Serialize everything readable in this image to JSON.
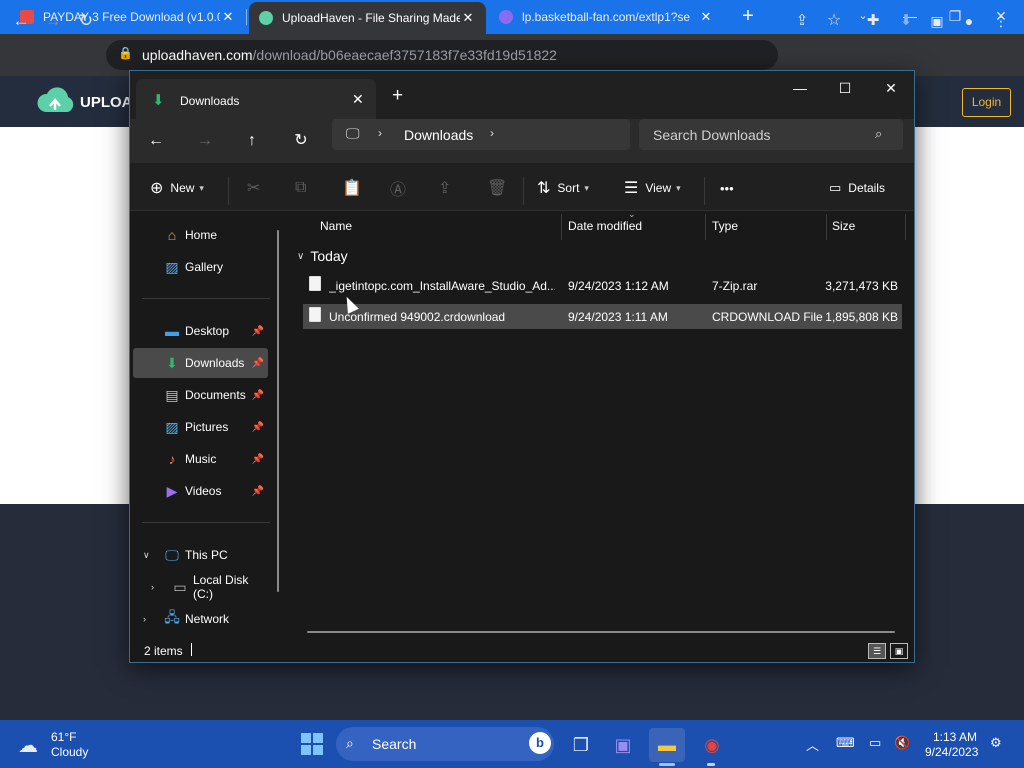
{
  "browser": {
    "tabs": [
      {
        "title": "PAYDAY 3 Free Download (v1.0.0",
        "active": false
      },
      {
        "title": "UploadHaven - File Sharing Made",
        "active": true
      },
      {
        "title": "lp.basketball-fan.com/extlp1?se",
        "active": false
      }
    ],
    "url_domain": "uploadhaven.com",
    "url_path": "/download/b06eaecaef3757183f7e33fd19d51822"
  },
  "site": {
    "name": "UPLOA",
    "login_label": "Login",
    "accent_color": "#f2b632"
  },
  "explorer": {
    "tab_title": "Downloads",
    "address": {
      "location": "Downloads"
    },
    "search_placeholder": "Search Downloads",
    "commands": {
      "new": "New",
      "sort": "Sort",
      "view": "View",
      "more": "•••",
      "details": "Details"
    },
    "sidebar": {
      "quick": [
        {
          "label": "Home",
          "icon": "home-icon"
        },
        {
          "label": "Gallery",
          "icon": "gallery-icon"
        }
      ],
      "pinned": [
        {
          "label": "Desktop",
          "icon": "desktop-icon"
        },
        {
          "label": "Downloads",
          "icon": "download-icon",
          "selected": true
        },
        {
          "label": "Documents",
          "icon": "documents-icon"
        },
        {
          "label": "Pictures",
          "icon": "pictures-icon"
        },
        {
          "label": "Music",
          "icon": "music-icon"
        },
        {
          "label": "Videos",
          "icon": "videos-icon"
        }
      ],
      "tree": [
        {
          "label": "This PC",
          "icon": "computer-icon",
          "expanded": true
        },
        {
          "label": "Local Disk (C:)",
          "icon": "drive-icon"
        },
        {
          "label": "Network",
          "icon": "network-icon"
        }
      ]
    },
    "columns": {
      "name": "Name",
      "date": "Date modified",
      "type": "Type",
      "size": "Size"
    },
    "group": "Today",
    "files": [
      {
        "name": "_igetintopc.com_InstallAware_Studio_Ad...",
        "date": "9/24/2023 1:12 AM",
        "type": "7-Zip.rar",
        "size": "3,271,473 KB"
      },
      {
        "name": "Unconfirmed 949002.crdownload",
        "date": "9/24/2023 1:11 AM",
        "type": "CRDOWNLOAD File",
        "size": "1,895,808 KB"
      }
    ],
    "status": {
      "count": "2 items"
    }
  },
  "taskbar": {
    "weather": {
      "temp": "61°F",
      "condition": "Cloudy"
    },
    "search_label": "Search",
    "bing": "b",
    "time": "1:13 AM",
    "date": "9/24/2023"
  }
}
